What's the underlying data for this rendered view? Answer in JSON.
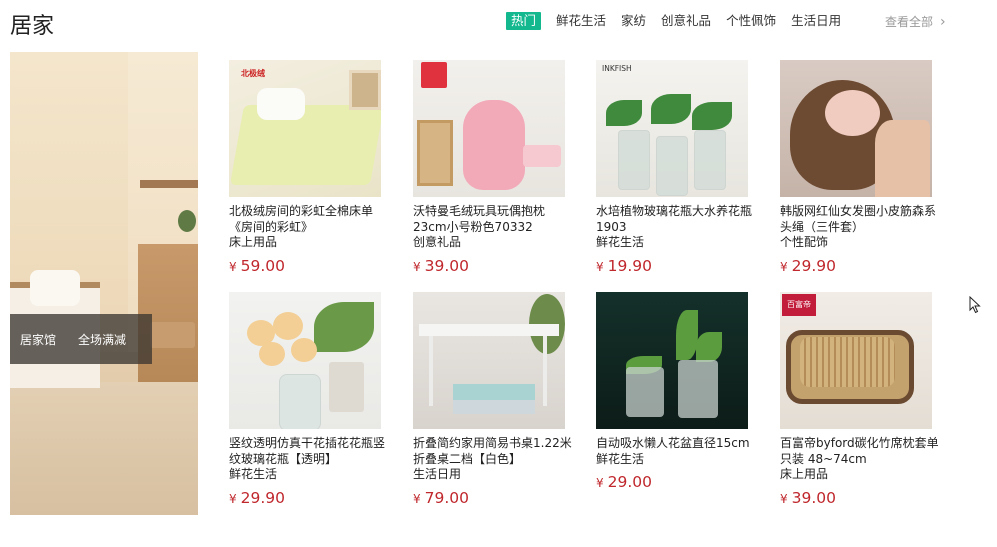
{
  "page": {
    "title": "居家"
  },
  "tabs": [
    {
      "label": "热门",
      "active": true
    },
    {
      "label": "鲜花生活",
      "active": false
    },
    {
      "label": "家纺",
      "active": false
    },
    {
      "label": "创意礼品",
      "active": false
    },
    {
      "label": "个性佩饰",
      "active": false
    },
    {
      "label": "生活日用",
      "active": false
    }
  ],
  "more": {
    "label": "查看全部",
    "icon": "chevron-right-icon"
  },
  "banner": {
    "label1": "居家馆",
    "label2": "全场满减"
  },
  "currency": "¥",
  "products": [
    {
      "name": "北极绒房间的彩虹全棉床单《房间的彩虹》",
      "category": "床上用品",
      "price": "59.00",
      "badge": "北极绒"
    },
    {
      "name": "沃特曼毛绒玩具玩偶抱枕23cm小号粉色70332",
      "category": "创意礼品",
      "price": "39.00"
    },
    {
      "name": "水培植物玻璃花瓶大水养花瓶1903",
      "category": "鲜花生活",
      "price": "19.90",
      "badge": "INKFISH"
    },
    {
      "name": "韩版网红仙女发圈小皮筋森系头绳（三件套）",
      "category": "个性配饰",
      "price": "29.90"
    },
    {
      "name": "竖纹透明仿真干花插花花瓶竖纹玻璃花瓶【透明】",
      "category": "鲜花生活",
      "price": "29.90"
    },
    {
      "name": "折叠简约家用简易书桌1.22米折叠桌二档【白色】",
      "category": "生活日用",
      "price": "79.00"
    },
    {
      "name": "自动吸水懒人花盆直径15cm",
      "category": "鲜花生活",
      "price": "29.00"
    },
    {
      "name": "百富帝byford碳化竹席枕套单只装 48~74cm",
      "category": "床上用品",
      "price": "39.00",
      "badge": "百富帝"
    }
  ]
}
